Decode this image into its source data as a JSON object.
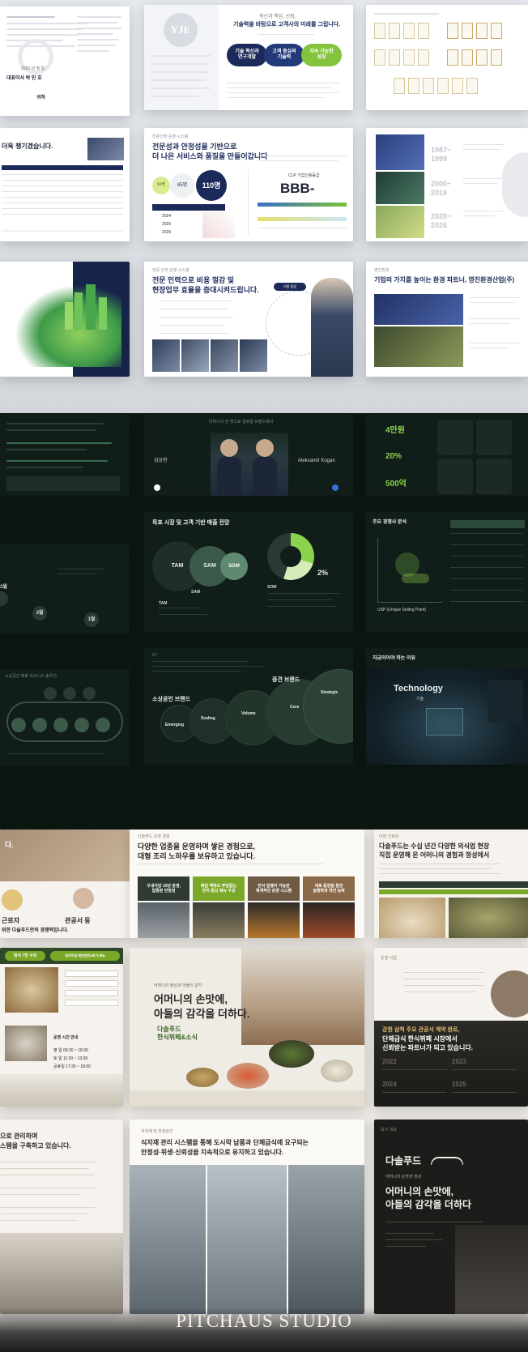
{
  "brand": {
    "name": "PITCHAUS STUDIO"
  },
  "colors": {
    "navy": "#1c2a5a",
    "green": "#7cc23a",
    "dark_bg": "#111d18",
    "accent_green": "#8bd34e",
    "food_brown": "#6f5a44"
  },
  "row1": {
    "left": {
      "title_frag": "대표이사 박 인 호",
      "foot": "귀하"
    },
    "center": {
      "logo": "YJE",
      "tagline": "혁신과 책임, 신뢰,",
      "headline": "기술력을 바탕으로 고객사의 미래를 그립니다.",
      "pills": [
        "기술 혁신과\n연구개발",
        "고객 중심의\n기술력",
        "지속 가능한\n성장"
      ]
    }
  },
  "row2": {
    "left": {
      "headline": "더욱 챙기겠습니다."
    },
    "center": {
      "headline_1": "전문성과 안정성을 기반으로",
      "headline_2": "더 나은 서비스와 품질을 만들어갑니다",
      "stat": "110명",
      "rating": "BBB-",
      "years": [
        "2024",
        "2025",
        "2026"
      ]
    },
    "right": {
      "years": [
        "1987~\n1999",
        "2000~\n2019",
        "2020~\n2026"
      ]
    }
  },
  "row3": {
    "center": {
      "headline_1": "전문 인력으로 비용 절감 및",
      "headline_2": "현장업무 효율을 증대시켜드립니다."
    },
    "right": {
      "headline": "기업의 가치를 높이는 환경 파트너, 영진환경산업(주)"
    }
  },
  "row4": {
    "center": {
      "name_left": "김상현",
      "name_right": "Aleksandr Kogan"
    },
    "right": {
      "stats": [
        "4만원",
        "20%",
        "500억"
      ]
    }
  },
  "row5": {
    "center": {
      "title": "목표 시장 및 고객 기반 매출 전망",
      "circles": [
        "TAM",
        "SAM",
        "SOM"
      ],
      "percent": "2%",
      "market_tam": "TAM",
      "market_sam": "SAM",
      "market_som": "SOM"
    },
    "left": {
      "labels": [
        "3월",
        "3월",
        "1월"
      ]
    },
    "right": {
      "title": "주요 경쟁사 분석",
      "note": "USP (Unique Selling Point)"
    }
  },
  "row6": {
    "center": {
      "big_1": "소상공인 브랜드",
      "big_2": "중견 브랜드",
      "bubbles": [
        "Emerging",
        "Scaling",
        "Volume",
        "Core",
        "Strategic"
      ]
    },
    "right": {
      "title": "지금이어야 하는 이유",
      "center_text": "Technology",
      "sub": "기술"
    }
  },
  "row7": {
    "left": {
      "labels": [
        "근로자",
        "관공서 등"
      ],
      "foot": "위한 다솔푸드만의 경쟁력입니다."
    },
    "center": {
      "headline_1": "다양한 업종을 운영하며 쌓은 경험으로,",
      "headline_2": "대형 조리 노하우를 보유하고 있습니다.",
      "cards": [
        "구내식당 10년 운영,\n입증된 안정성",
        "배달 맥락도 부담없는\n현지 중심 메뉴 구성",
        "한식 덮뱅이 가능한\n체계적인 운영 시스템",
        "새로 등장을 통한\n실행력과 개선 능력"
      ]
    },
    "right": {
      "headline_1": "다솔푸드는 수십 년간 다양한 외식업 현장",
      "headline_2": "직접 운영해 온 어머니의 경험과 정성에서"
    }
  },
  "row8": {
    "center": {
      "headline_1": "어머니의 손맛에,",
      "headline_2": "아들의 감각을 더하다.",
      "stamp": "다솔푸드\n한식뷔페&소식",
      "label": "어머니의 정성과 아들의 감각"
    },
    "left": {
      "tags": [
        "정식 7찬 구성",
        "프리미엄 메인반찬&추가 메뉴"
      ],
      "hours_title": "운영 시간 안내",
      "hours": [
        "평 일  09:30 ~ 18:30",
        "토 일  11:30 ~ 13:30",
        "공휴일  17:30 ~ 18:00"
      ]
    },
    "right": {
      "headline_1": "강원 삼척 주요 관공서 계약 완료,",
      "headline_2": "단체급식 한식뷔페 시장에서",
      "headline_3": "신뢰받는 파트너가 되고 있습니다.",
      "years": [
        "2022",
        "2023",
        "2024",
        "2025"
      ]
    }
  },
  "row9": {
    "left": {
      "headline_1": "으로 관리하며",
      "headline_2": "스템을 구축하고 있습니다."
    },
    "center": {
      "headline_1": "식자재 관리 시스템을 통해 도시락 납품과 단체급식에 요구되는",
      "headline_2": "안정성·위생·신뢰성을 지속적으로 유지하고 있습니다."
    },
    "right": {
      "logo": "다솔푸드",
      "headline_1": "어머니의 손맛에,",
      "headline_2": "아들의 감각을 더하다"
    }
  }
}
